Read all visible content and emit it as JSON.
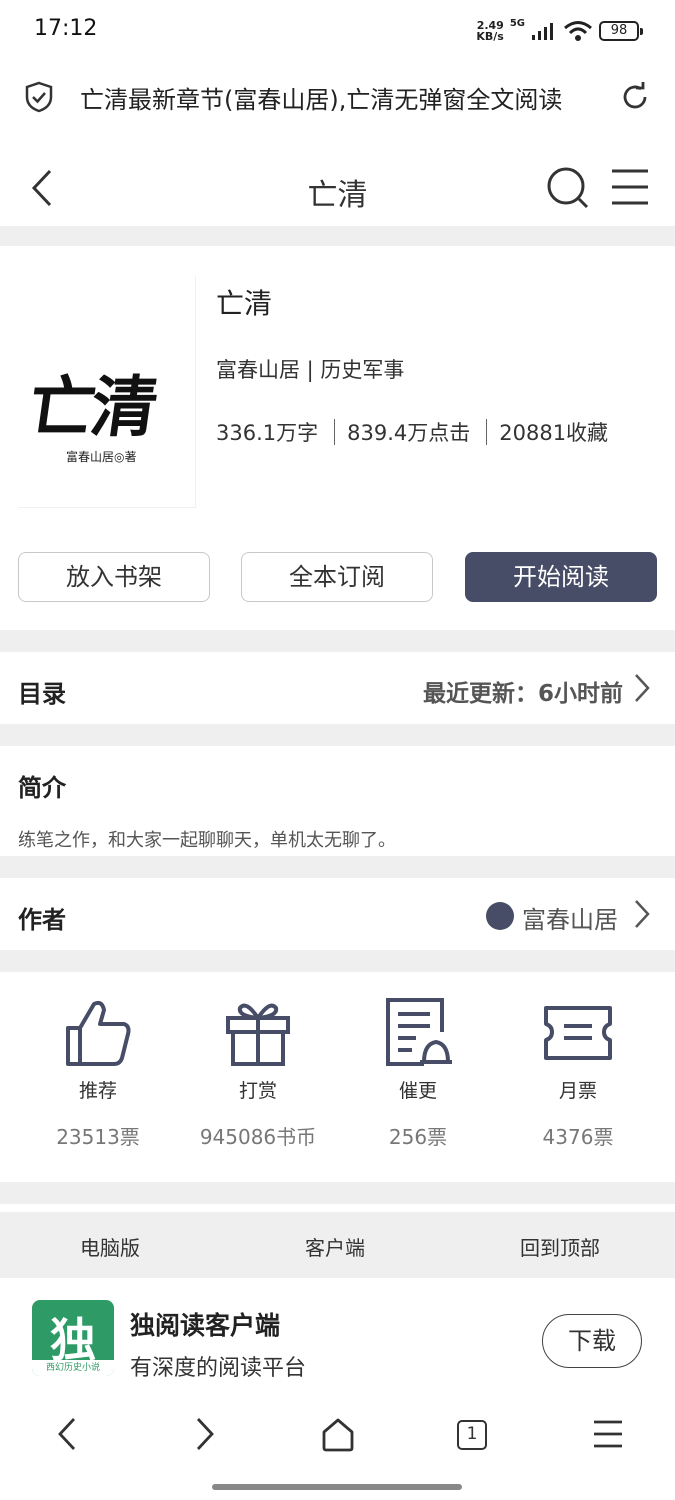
{
  "status_bar": {
    "time": "17:12",
    "net_speed_top": "2.49",
    "net_speed_bottom": "KB/s",
    "network": "5G",
    "battery": "98"
  },
  "url_bar": {
    "title": "亡清最新章节(富春山居),亡清无弹窗全文阅读"
  },
  "header": {
    "title": "亡清"
  },
  "book": {
    "cover_title": "亡清",
    "cover_author": "富春山居◎著",
    "title": "亡清",
    "meta": "富春山居 | 历史军事",
    "words": "336.1万字",
    "clicks": "839.4万点击",
    "favorites": "20881收藏"
  },
  "actions": {
    "add_shelf": "放入书架",
    "subscribe_all": "全本订阅",
    "start_reading": "开始阅读"
  },
  "toc": {
    "label": "目录",
    "latest_update": "最近更新：6小时前"
  },
  "intro": {
    "label": "简介",
    "text": "练笔之作，和大家一起聊聊天，单机太无聊了。"
  },
  "author": {
    "label": "作者",
    "name": "富春山居"
  },
  "votes": [
    {
      "icon": "thumbs-up-icon",
      "label": "推荐",
      "count": "23513票"
    },
    {
      "icon": "gift-icon",
      "label": "打赏",
      "count": "945086书币"
    },
    {
      "icon": "update-reminder-icon",
      "label": "催更",
      "count": "256票"
    },
    {
      "icon": "ticket-icon",
      "label": "月票",
      "count": "4376票"
    }
  ],
  "footer": {
    "desktop": "电脑版",
    "client": "客户端",
    "back_top": "回到顶部"
  },
  "app_promo": {
    "logo_char": "独",
    "logo_sub": "西幻历史小说",
    "name": "独阅读客户端",
    "tagline": "有深度的阅读平台",
    "download": "下载"
  },
  "browser_nav": {
    "tab_count": "1"
  },
  "colors": {
    "accent": "#474d66",
    "app_green": "#2e9b67",
    "gap_gray": "#efefef"
  }
}
